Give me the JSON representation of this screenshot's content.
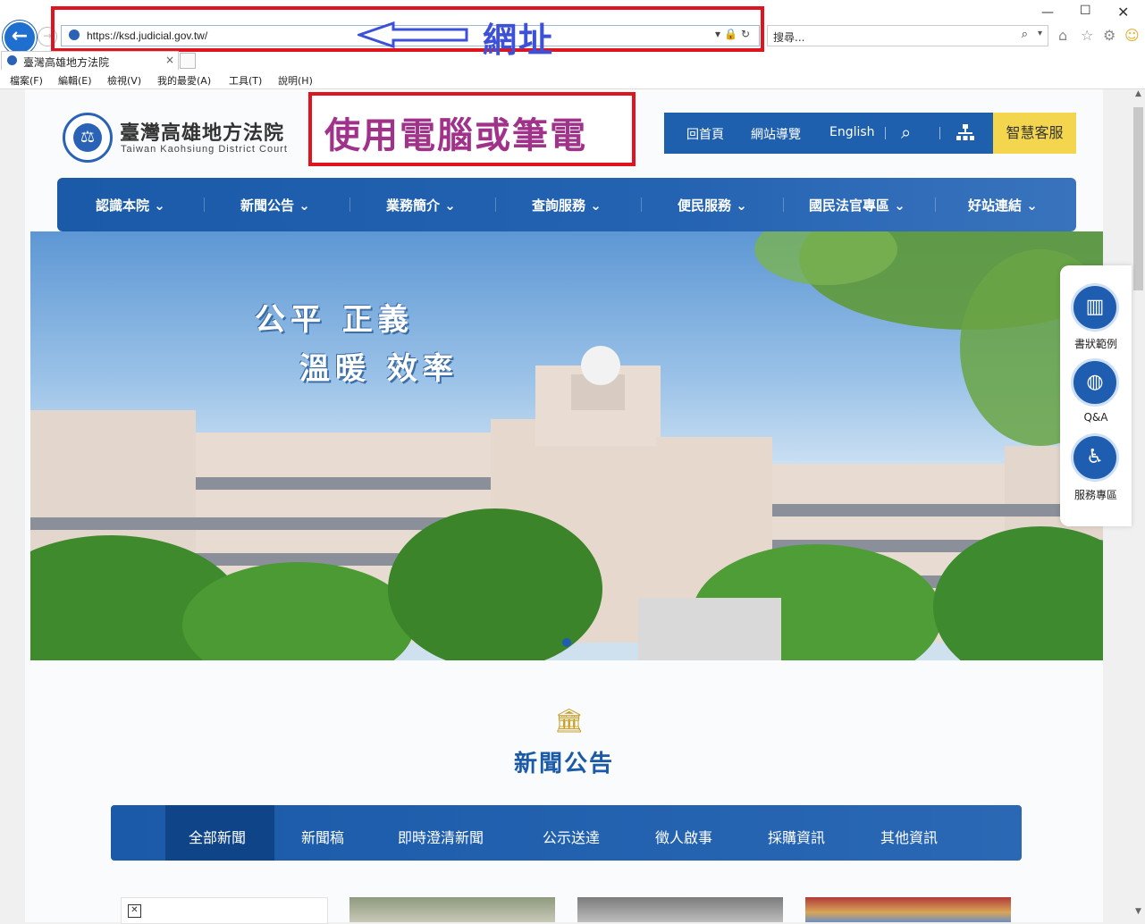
{
  "browser": {
    "url": "https://ksd.judicial.gov.tw/",
    "search_placeholder": "搜尋...",
    "tab_title": "臺灣高雄地方法院",
    "tab_close": "×",
    "window_min": "—",
    "window_max": "☐",
    "window_close": "✕",
    "menu": [
      "檔案(F)",
      "編輯(E)",
      "檢視(V)",
      "我的最愛(A)",
      "工具(T)",
      "說明(H)"
    ]
  },
  "annotations": {
    "url_label": "網址",
    "device_label": "使用電腦或筆電",
    "highlight_color": "#e0141e"
  },
  "site": {
    "title": "臺灣高雄地方法院",
    "subtitle": "Taiwan Kaohsiung District Court",
    "top_nav": [
      "回首頁",
      "網站導覽",
      "English"
    ],
    "help_button": "智慧客服",
    "main_nav": [
      "認識本院 ⌄",
      "新聞公告 ⌄",
      "業務簡介 ⌄",
      "查詢服務 ⌄",
      "便民服務 ⌄",
      "國民法官專區 ⌄",
      "好站連結 ⌄"
    ],
    "hero_slogan_line1": "公平 正義",
    "hero_slogan_line2": "溫暖 效率",
    "sidebar": [
      "書狀範例",
      "Q&A",
      "服務專區"
    ],
    "news_heading": "新聞公告",
    "news_tabs": [
      "全部新聞",
      "新聞稿",
      "即時澄清新聞",
      "公示送達",
      "徵人啟事",
      "採購資訊",
      "其他資訊"
    ],
    "brand_color": "#1e5fae",
    "accent_color": "#f3d54e"
  }
}
